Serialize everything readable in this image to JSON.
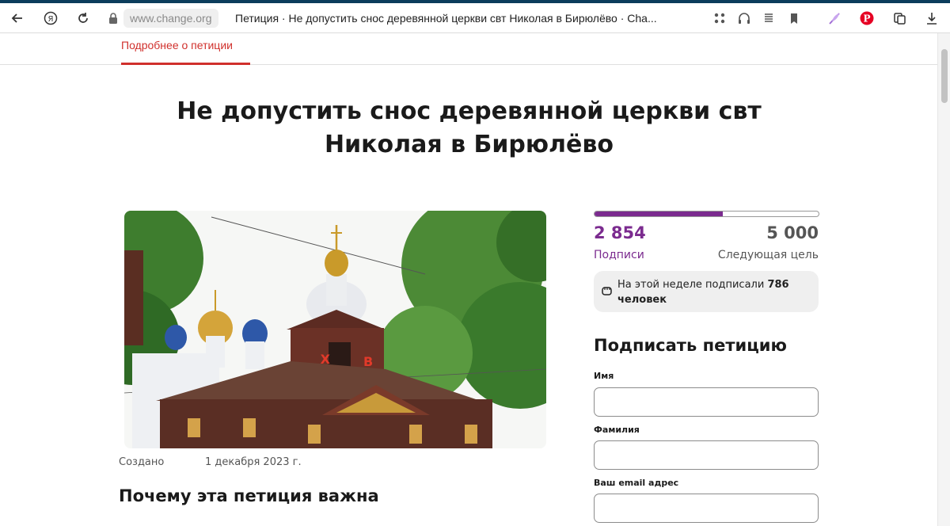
{
  "browser": {
    "url": "www.change.org",
    "tab_title": "Петиция · Не допустить снос деревянной церкви свт Николая в Бирюлёво · Cha..."
  },
  "subnav": {
    "tab_label": "Подробнее о петиции"
  },
  "petition": {
    "title": "Не допустить снос деревянной церкви свт Николая в Бирюлёво",
    "created_label": "Создано",
    "created_date": "1 декабря 2023 г.",
    "why_heading": "Почему эта петиция важна",
    "photo_sign_left": "Х",
    "photo_sign_right": "В"
  },
  "signatures": {
    "count_text": "2 854",
    "count_label": "Подписи",
    "goal_text": "5 000",
    "goal_label": "Следующая цель",
    "progress_fraction": 0.571,
    "week_prefix": "На этой неделе подписали",
    "week_count": "786",
    "week_suffix": "человек"
  },
  "sign_form": {
    "heading": "Подписать петицию",
    "first_name_label": "Имя",
    "last_name_label": "Фамилия",
    "email_label": "Ваш email адрес"
  },
  "colors": {
    "accent": "#d0302c",
    "progress": "#7b2b8f"
  }
}
